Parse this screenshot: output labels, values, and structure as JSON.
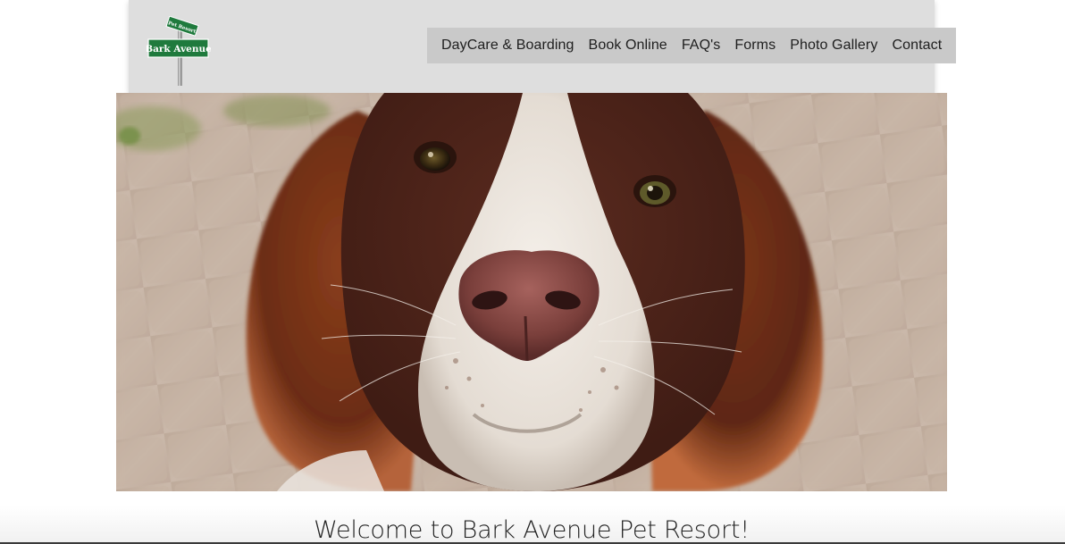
{
  "logo": {
    "sign_top": "Pet Resort",
    "sign_main": "Bark Avenue"
  },
  "nav": {
    "items": [
      {
        "label": "DayCare & Boarding"
      },
      {
        "label": "Book Online"
      },
      {
        "label": "FAQ's"
      },
      {
        "label": "Forms"
      },
      {
        "label": "Photo Gallery"
      },
      {
        "label": "Contact"
      }
    ]
  },
  "hero": {
    "image": "dog-closeup-photo"
  },
  "main": {
    "heading": "Welcome to Bark Avenue Pet Resort!"
  },
  "colors": {
    "header_bg": "#dedede",
    "nav_bg": "#c9c9c9",
    "sign_green": "#1f7a3d"
  }
}
